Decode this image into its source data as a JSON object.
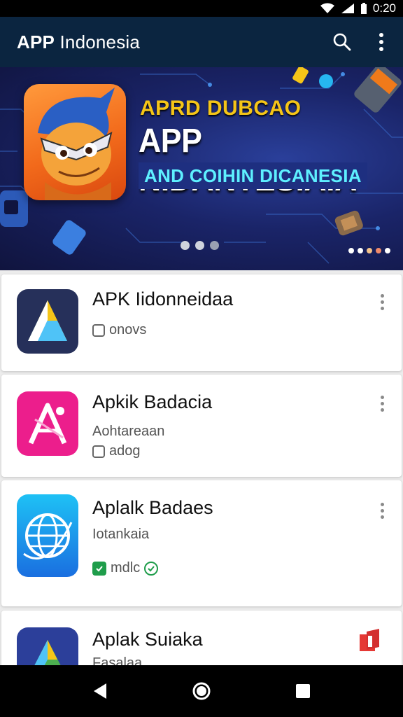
{
  "status_bar": {
    "time": "0:20",
    "icons": [
      "wifi-icon",
      "signal-icon",
      "battery-icon"
    ]
  },
  "app_bar": {
    "title_bold": "APP",
    "title_rest": " Indonesia",
    "actions": [
      "search-icon",
      "more-vert-icon"
    ]
  },
  "banner": {
    "line1": "APRD DUBCAO",
    "line2": "APP NIDANTESIAIA",
    "line3": "AND COIHIN DICANESIA",
    "page_indicator": {
      "count": 3,
      "active": 0
    }
  },
  "apps": [
    {
      "title": "APK Iidonneidaa",
      "subtitle": "",
      "meta": "onovs",
      "meta_icon": "box-icon",
      "icon": "triangle-logo-icon",
      "icon_bg": "#26305a"
    },
    {
      "title": "Apkik Badacia",
      "subtitle": "Aohtareaan",
      "meta": "adog",
      "meta_icon": "box-icon",
      "icon": "pen-logo-icon",
      "icon_bg": "#ec1e8c"
    },
    {
      "title": "Aplalk Badaes",
      "subtitle": "Iotankaia",
      "meta": "mdlc",
      "meta_icon": "check-badge-icon",
      "icon": "globe-icon",
      "icon_bg": "#1a8fe6"
    },
    {
      "title": "Aplak Suiaka",
      "subtitle": "Fasalaa",
      "meta": "",
      "meta_icon": "",
      "icon": "triangle-logo-icon",
      "icon_bg": "#2c3f9a"
    }
  ],
  "colors": {
    "app_bar": "#0b2540",
    "accent_cyan": "#5ef0ff",
    "accent_gold": "#f5c518",
    "badge_green": "#1f9d4b"
  }
}
